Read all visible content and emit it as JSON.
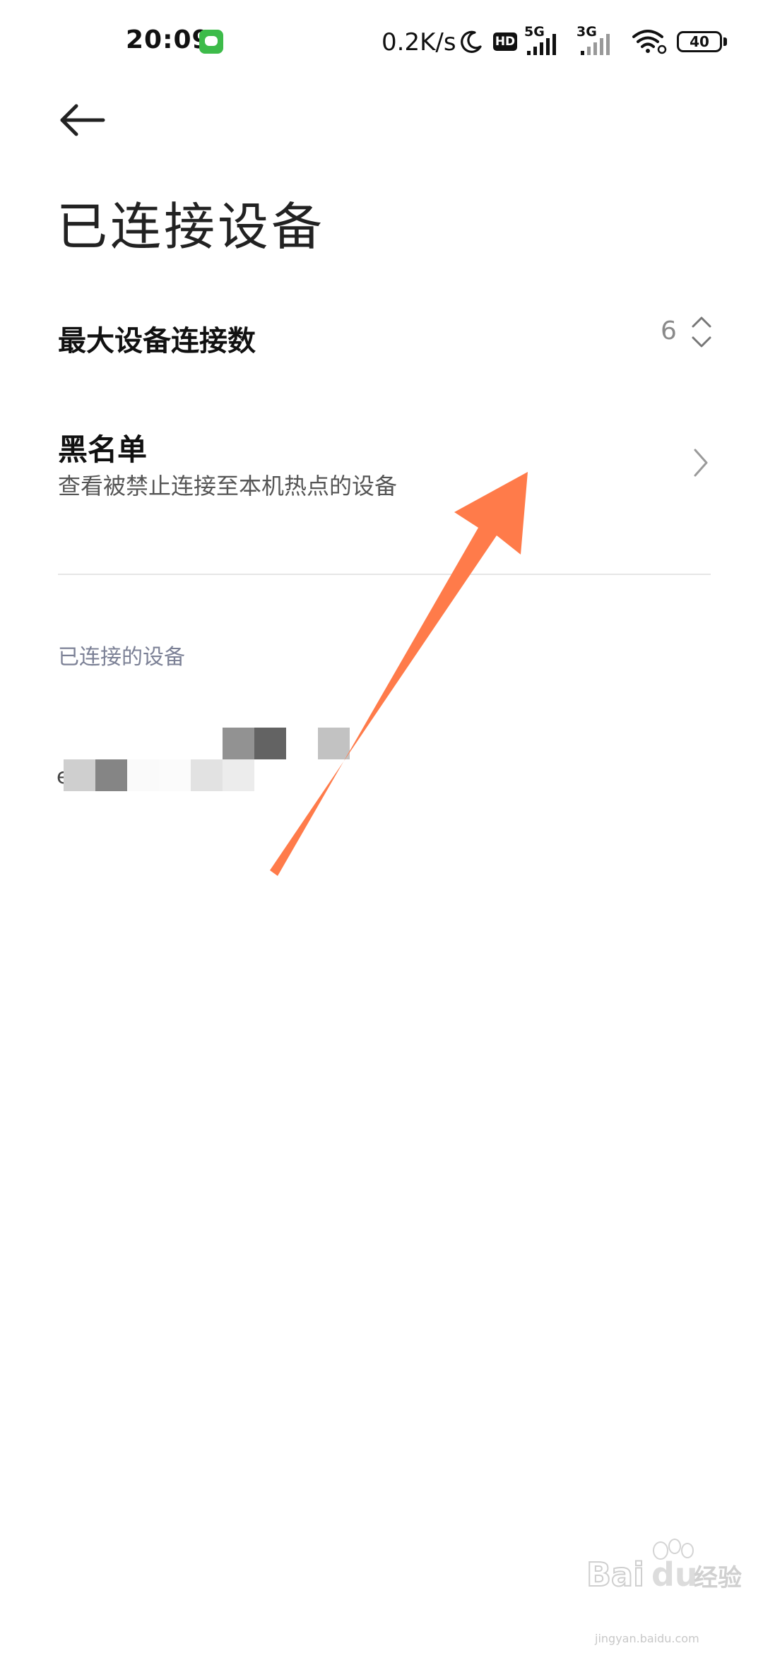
{
  "status_bar": {
    "time": "20:09",
    "net_speed": "0.2K/s",
    "hd_label": "HD",
    "signal_1_label": "5G",
    "signal_2_label": "3G",
    "battery": "40",
    "icons": [
      "app-notification-icon",
      "moon-icon",
      "signal-icon",
      "wifi-icon",
      "battery-icon"
    ]
  },
  "header": {
    "back_icon": "back-arrow-icon",
    "title": "已连接设备"
  },
  "settings": {
    "max_connections": {
      "label": "最大设备连接数",
      "value": "6"
    },
    "blacklist": {
      "title": "黑名单",
      "subtitle": "查看被禁止连接至本机热点的设备"
    }
  },
  "connected_section": {
    "header": "已连接的设备",
    "devices": [
      {
        "name": "e"
      }
    ]
  },
  "overlay": {
    "arrow_color": "#ff7b4a"
  },
  "watermark": {
    "logo_text": "Bai du 经验",
    "domain": "jingyan.baidu.com"
  },
  "colors": {
    "background": "#ffffff",
    "divider": "#e6e6e6",
    "section_header": "#7c8196",
    "app_badge": "#3dbb4a"
  }
}
